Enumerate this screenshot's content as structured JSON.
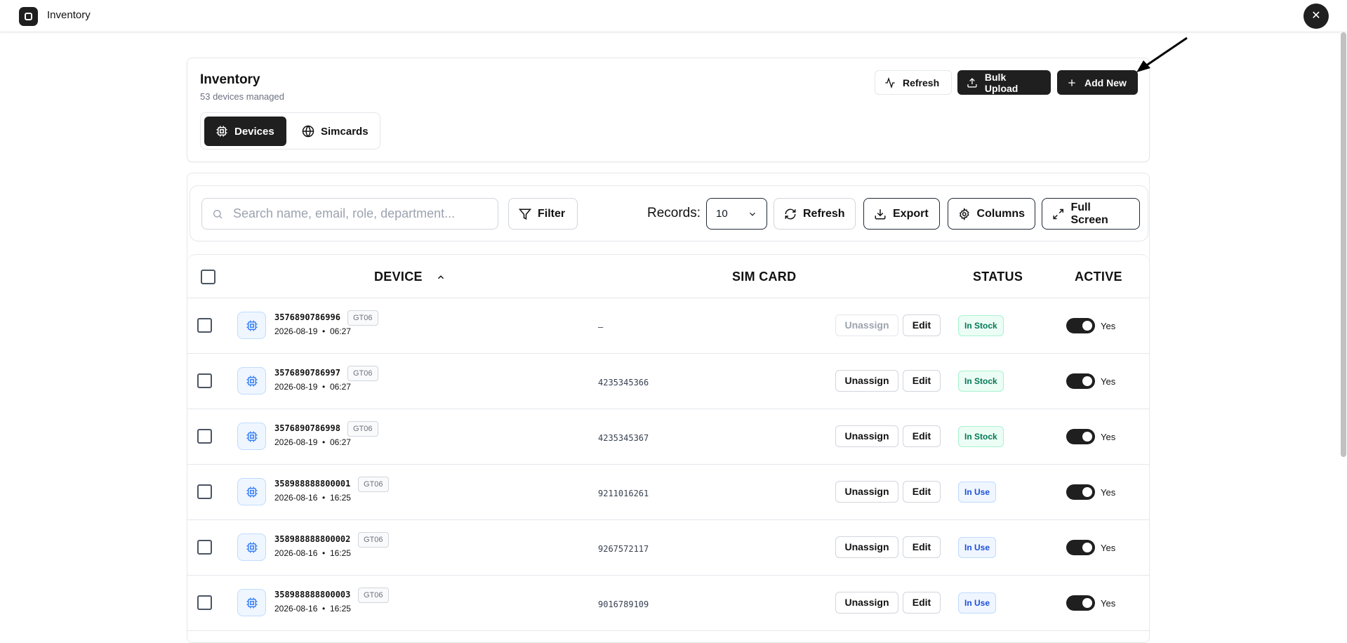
{
  "window": {
    "title": "Inventory",
    "close_label": "✕"
  },
  "header": {
    "title": "Inventory",
    "subtitle": "53 devices managed",
    "tabs": [
      {
        "label": "Devices"
      },
      {
        "label": "Simcards"
      }
    ],
    "buttons": {
      "refresh": "Refresh",
      "bulk_upload": "Bulk Upload",
      "add_new": "Add New"
    }
  },
  "toolbar": {
    "search_placeholder": "Search name, email, role, department...",
    "filter": "Filter",
    "records_label": "Records:",
    "records_value": "10",
    "refresh": "Refresh",
    "export": "Export",
    "columns": "Columns",
    "full_screen": "Full Screen"
  },
  "table": {
    "columns": {
      "device": "DEVICE",
      "sim_card": "SIM CARD",
      "status": "STATUS",
      "active": "ACTIVE"
    },
    "rows": [
      {
        "id": "3576890786996",
        "model": "GT06",
        "date": "2026-08-19",
        "time": "06:27",
        "sim": "–",
        "unassign": "Unassign",
        "edit": "Edit",
        "status": "In Stock",
        "active": "Yes"
      },
      {
        "id": "3576890786997",
        "model": "GT06",
        "date": "2026-08-19",
        "time": "06:27",
        "sim": "4235345366",
        "unassign": "Unassign",
        "edit": "Edit",
        "status": "In Stock",
        "active": "Yes"
      },
      {
        "id": "3576890786998",
        "model": "GT06",
        "date": "2026-08-19",
        "time": "06:27",
        "sim": "4235345367",
        "unassign": "Unassign",
        "edit": "Edit",
        "status": "In Stock",
        "active": "Yes"
      },
      {
        "id": "358988888800001",
        "model": "GT06",
        "date": "2026-08-16",
        "time": "16:25",
        "sim": "9211016261",
        "unassign": "Unassign",
        "edit": "Edit",
        "status": "In Use",
        "active": "Yes"
      },
      {
        "id": "358988888800002",
        "model": "GT06",
        "date": "2026-08-16",
        "time": "16:25",
        "sim": "9267572117",
        "unassign": "Unassign",
        "edit": "Edit",
        "status": "In Use",
        "active": "Yes"
      },
      {
        "id": "358988888800003",
        "model": "GT06",
        "date": "2026-08-16",
        "time": "16:25",
        "sim": "9016789109",
        "unassign": "Unassign",
        "edit": "Edit",
        "status": "In Use",
        "active": "Yes"
      }
    ]
  },
  "colors": {
    "primary_dark": "#1f1f1f",
    "in_stock": "#047857",
    "in_use": "#1d4ed8",
    "device_icon": "#3b82f6"
  }
}
